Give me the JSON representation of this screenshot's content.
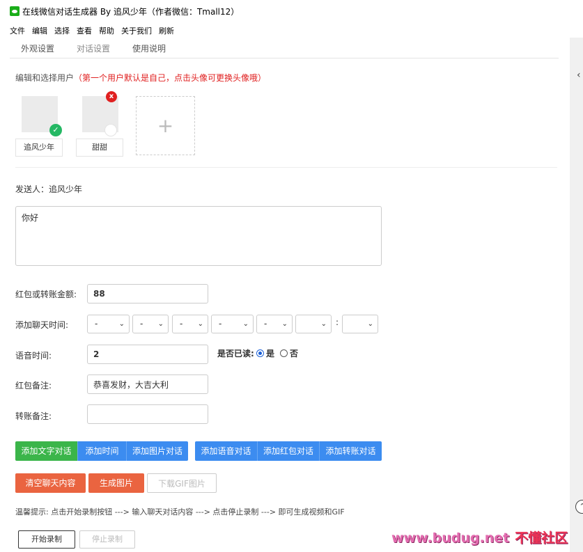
{
  "window": {
    "title": "在线微信对话生成器 By 追风少年（作者微信：Tmall12）"
  },
  "menu": [
    "文件",
    "编辑",
    "选择",
    "查看",
    "帮助",
    "关于我们",
    "刷新"
  ],
  "tabs": [
    {
      "label": "外观设置"
    },
    {
      "label": "对话设置"
    },
    {
      "label": "使用说明"
    }
  ],
  "users_section": {
    "heading": "编辑和选择用户",
    "hint": "（第一个用户默认是自己，点击头像可更换头像哦）",
    "users": [
      {
        "name": "追风少年",
        "selected": true
      },
      {
        "name": "甜甜",
        "selected": false,
        "delete_label": "x"
      }
    ],
    "add_symbol": "+"
  },
  "sender": {
    "label": "发送人：",
    "name": "追风少年"
  },
  "message": {
    "value": "你好"
  },
  "form": {
    "amount": {
      "label": "红包或转账金额:",
      "value": "88"
    },
    "chat_time": {
      "label": "添加聊天时间:",
      "selects": [
        "-",
        "-",
        "-",
        "-",
        "-",
        "",
        ""
      ],
      "colon": ":"
    },
    "voice_time": {
      "label": "语音时间:",
      "value": "2"
    },
    "read_status": {
      "label": "是否已读:",
      "options": [
        "是",
        "否"
      ],
      "selected": "是"
    },
    "redpacket_note": {
      "label": "红包备注:",
      "value": "恭喜发财，大吉大利"
    },
    "transfer_note": {
      "label": "转账备注:",
      "value": ""
    }
  },
  "buttons": {
    "add_text": "添加文字对话",
    "add_time": "添加时间",
    "add_image": "添加图片对话",
    "add_voice": "添加语音对话",
    "add_redpacket": "添加红包对话",
    "add_transfer": "添加转账对话",
    "clear_chat": "清空聊天内容",
    "generate_image": "生成图片",
    "download_gif": "下载GIF图片",
    "start_record": "开始录制",
    "stop_record": "停止录制"
  },
  "tip": "温馨提示: 点击开始录制按钮 ---> 输入聊天对话内容 ---> 点击停止录制 ---> 即可生成视频和GIF",
  "watermark": {
    "text": "www.budug.net",
    "cn": "不懂社区"
  },
  "colors": {
    "green": "#3bb54a",
    "blue": "#3c8cf0",
    "orange": "#ea6440",
    "red": "#e02020"
  }
}
